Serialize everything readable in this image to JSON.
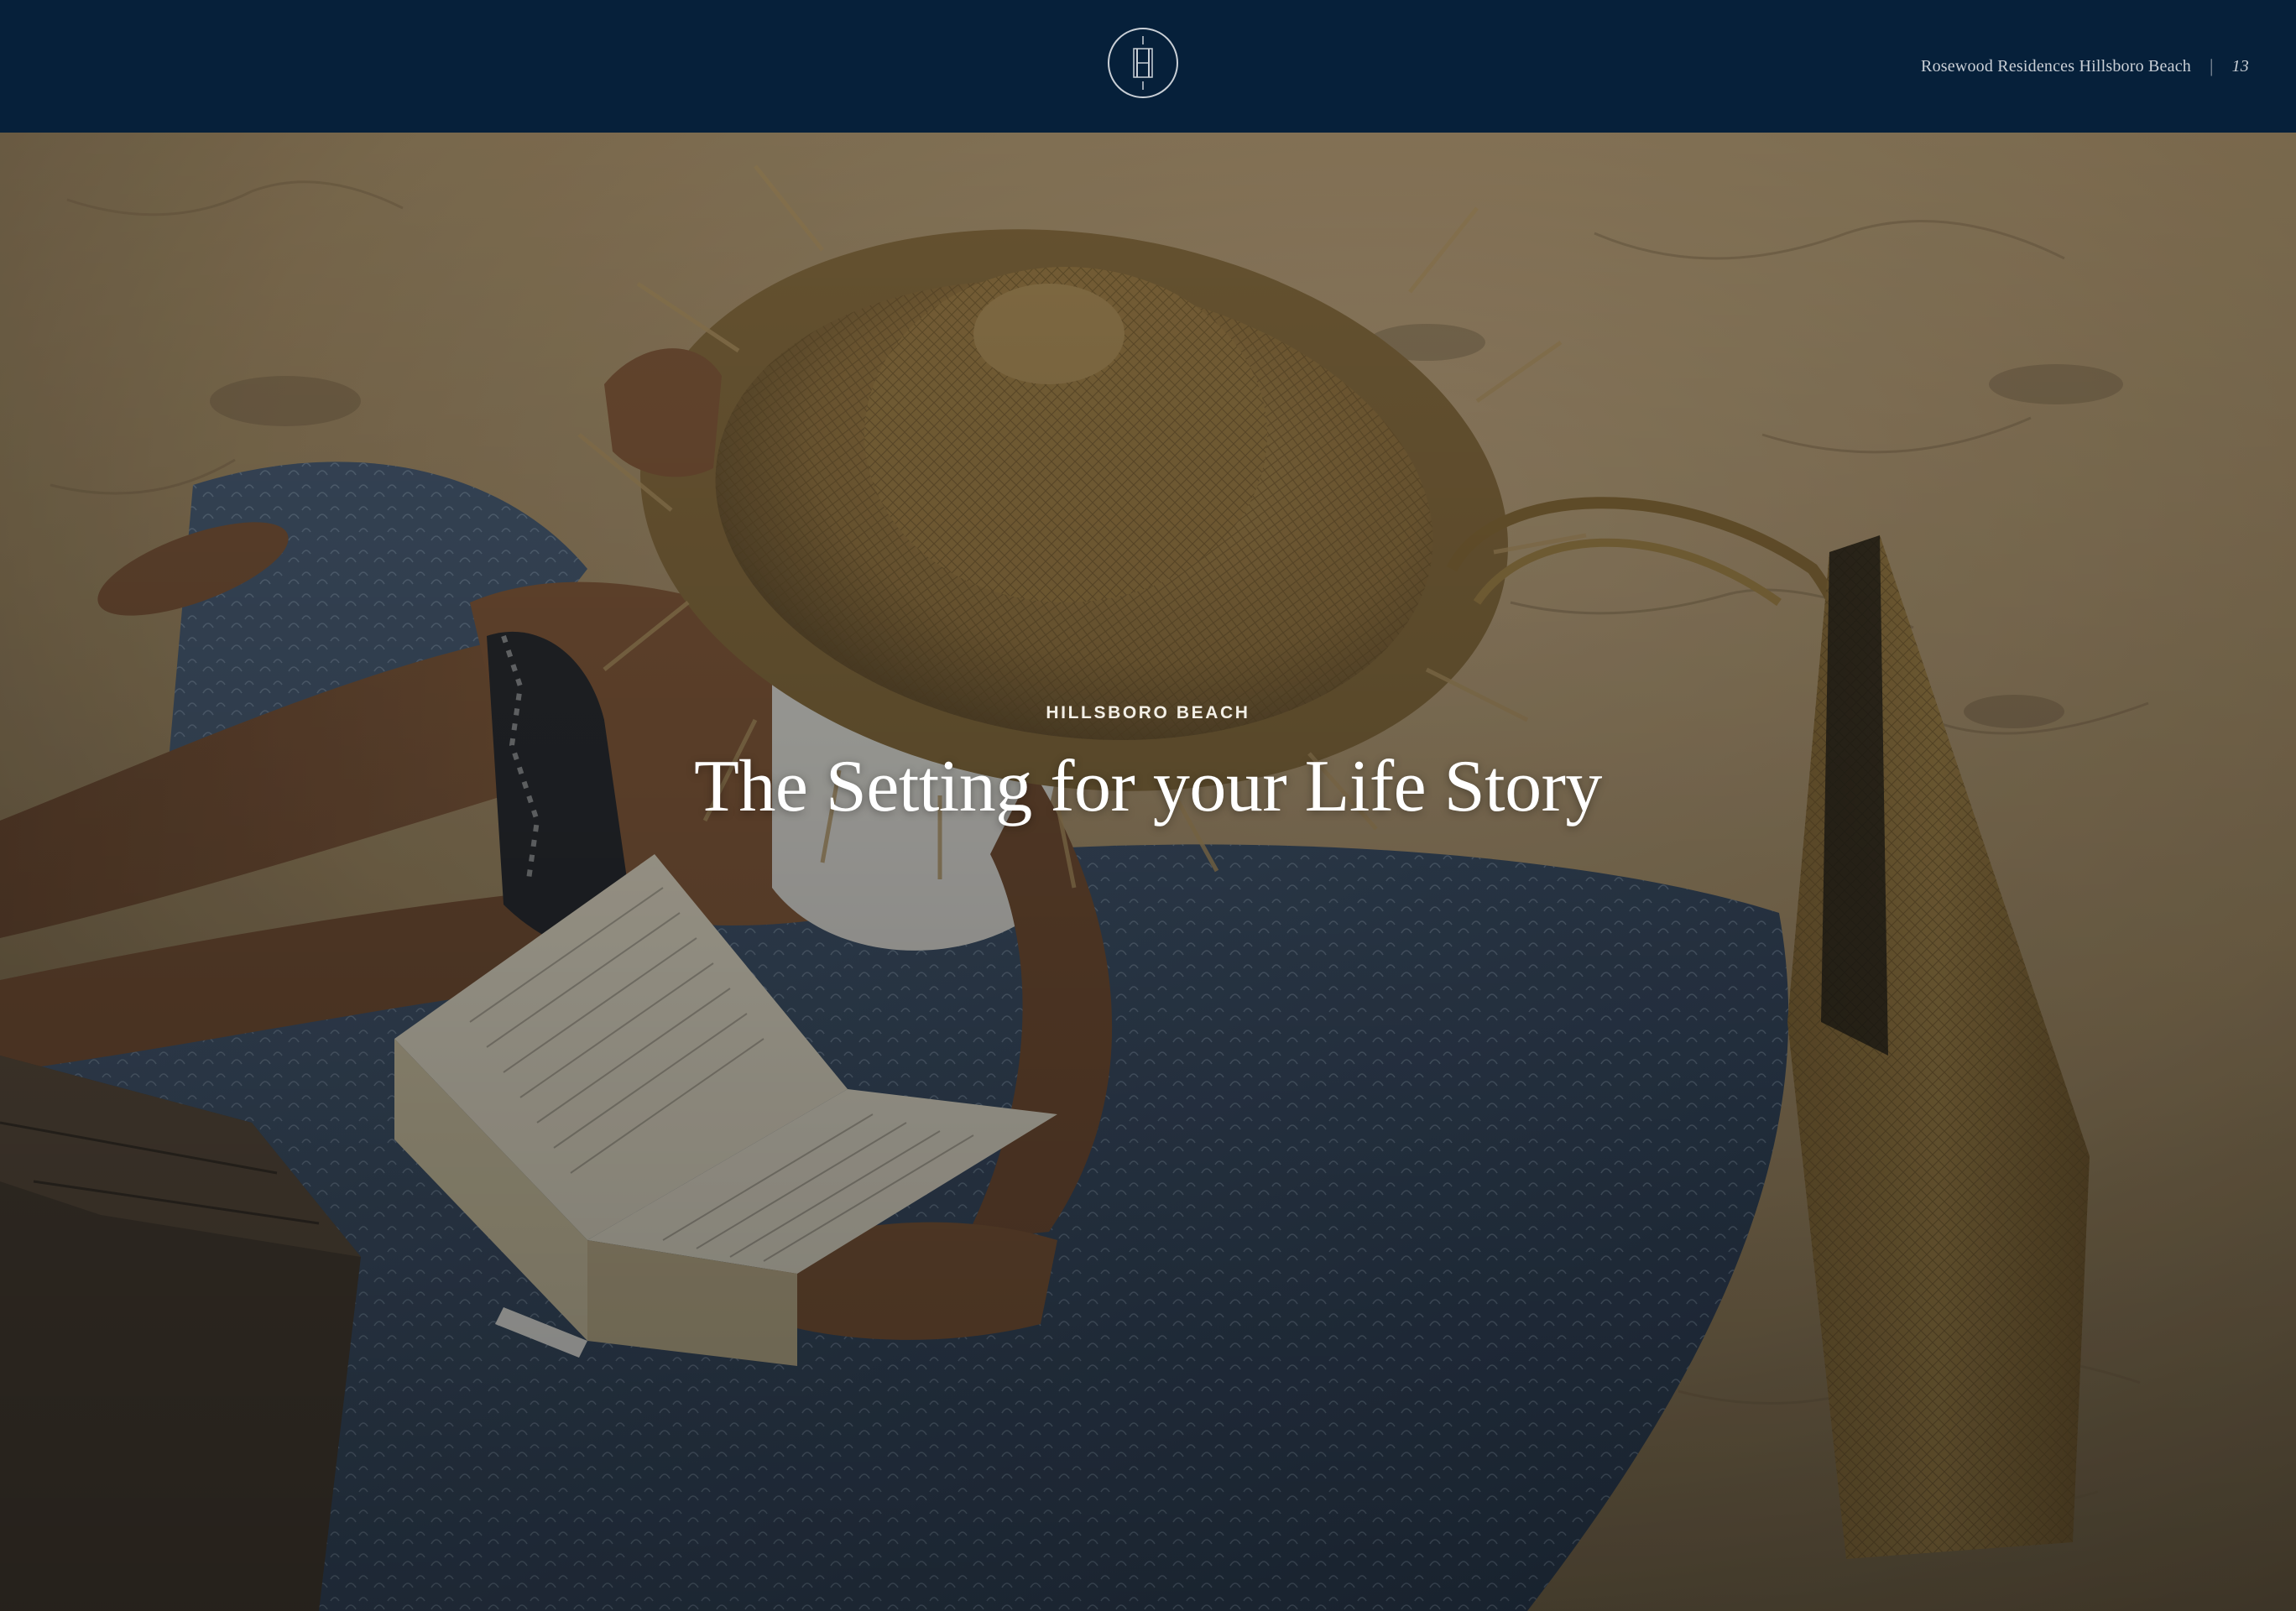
{
  "header": {
    "brand_line": "Rosewood Residences Hillsboro Beach",
    "separator": "|",
    "page_number": "13",
    "monogram_icon": "rosewood-monogram-icon"
  },
  "hero": {
    "eyebrow": "HILLSBORO BEACH",
    "headline": "The Setting for your Life Story"
  },
  "colors": {
    "header_bg": "#06203a",
    "sand": "#b49b74",
    "towel": "#40536d",
    "straw": "#a4834a"
  }
}
